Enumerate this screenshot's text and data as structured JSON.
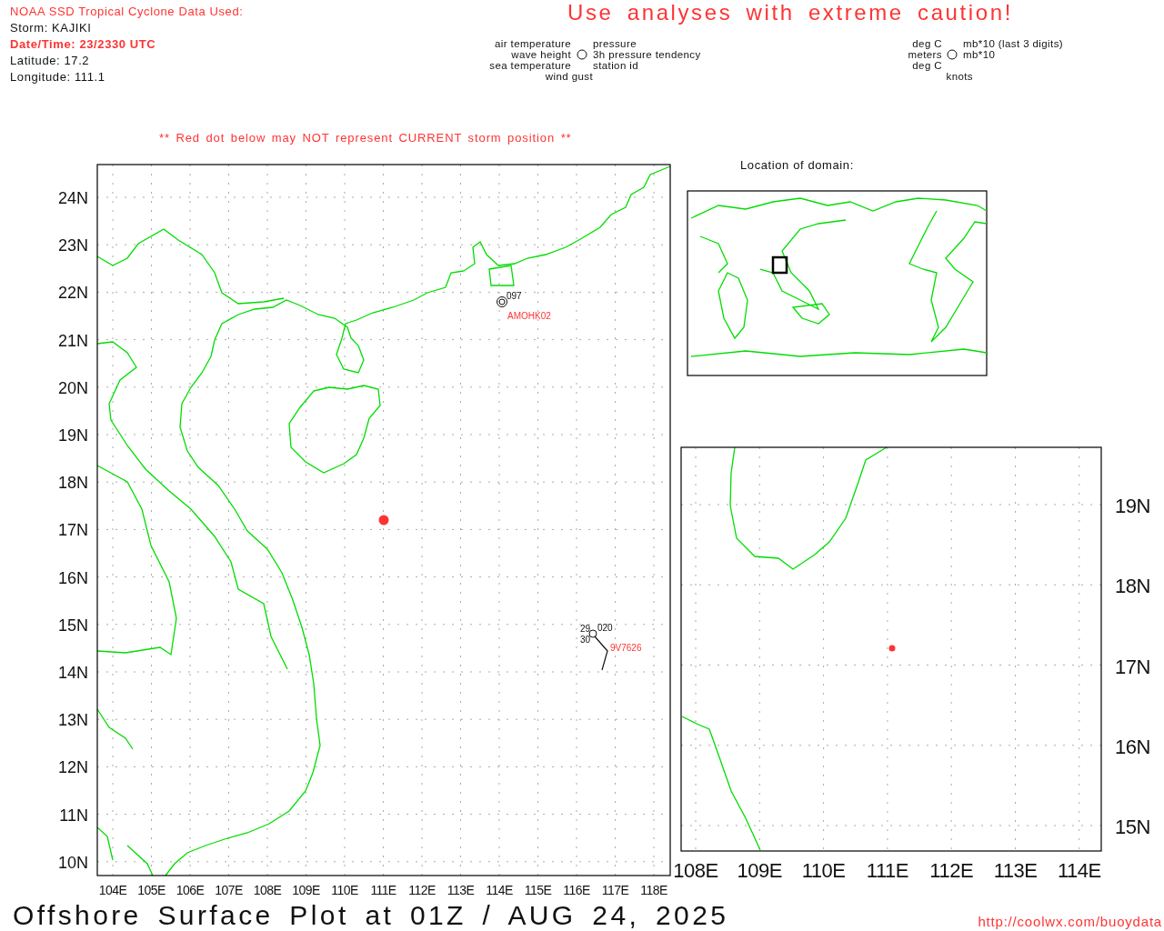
{
  "header": {
    "title": "NOAA SSD Tropical Cyclone Data Used:",
    "storm": "Storm: KAJIKI",
    "datetime": "Date/Time: 23/2330 UTC",
    "latitude": "Latitude: 17.2",
    "longitude": "Longitude: 111.1"
  },
  "caution": "Use analyses with extreme caution!",
  "legend": {
    "left": [
      "air temperature",
      "wave height",
      "sea temperature"
    ],
    "right": [
      "pressure",
      "3h pressure tendency",
      "station id"
    ],
    "bottom": "wind gust"
  },
  "units": {
    "left": [
      "deg C",
      "meters",
      "deg C"
    ],
    "right": [
      "mb*10 (last 3 digits)",
      "mb*10"
    ],
    "bottom": "knots"
  },
  "warning": "** Red dot below may NOT represent CURRENT storm position **",
  "main_map": {
    "lat_ticks": [
      "24N",
      "23N",
      "22N",
      "21N",
      "20N",
      "19N",
      "18N",
      "17N",
      "16N",
      "15N",
      "14N",
      "13N",
      "12N",
      "11N",
      "10N"
    ],
    "lon_ticks": [
      "104E",
      "105E",
      "106E",
      "107E",
      "108E",
      "109E",
      "110E",
      "111E",
      "112E",
      "113E",
      "114E",
      "115E",
      "116E",
      "117E",
      "118E"
    ],
    "stations": [
      {
        "kind": "fixed",
        "station_id": "AMOHK02",
        "pressure": "097"
      },
      {
        "kind": "ship",
        "station_id": "9V7626",
        "pressure": "020",
        "air_temperature": "29",
        "sea_temperature": "30"
      }
    ]
  },
  "location_map": {
    "title": "Location of domain:"
  },
  "zoom_map": {
    "lat_ticks": [
      "19N",
      "18N",
      "17N",
      "16N",
      "15N"
    ],
    "lon_ticks": [
      "108E",
      "109E",
      "110E",
      "111E",
      "112E",
      "113E",
      "114E"
    ]
  },
  "footer": {
    "title": "Offshore Surface Plot at 01Z / AUG 24, 2025",
    "url": "http://coolwx.com/buoydata"
  }
}
